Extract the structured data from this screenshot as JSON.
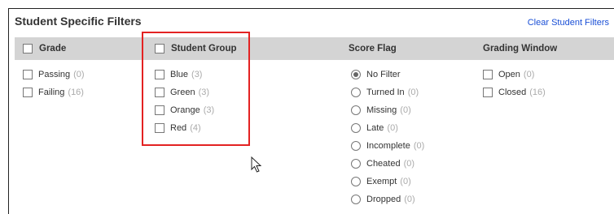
{
  "title": "Student Specific Filters",
  "clear_link": "Clear Student Filters",
  "columns": {
    "grade": {
      "header": "Grade",
      "items": [
        {
          "label": "Passing",
          "count": "(0)"
        },
        {
          "label": "Failing",
          "count": "(16)"
        }
      ]
    },
    "student_group": {
      "header": "Student Group",
      "items": [
        {
          "label": "Blue",
          "count": "(3)"
        },
        {
          "label": "Green",
          "count": "(3)"
        },
        {
          "label": "Orange",
          "count": "(3)"
        },
        {
          "label": "Red",
          "count": "(4)"
        }
      ]
    },
    "score_flag": {
      "header": "Score Flag",
      "selected": "No Filter",
      "items": [
        {
          "label": "No Filter",
          "count": ""
        },
        {
          "label": "Turned In",
          "count": "(0)"
        },
        {
          "label": "Missing",
          "count": "(0)"
        },
        {
          "label": "Late",
          "count": "(0)"
        },
        {
          "label": "Incomplete",
          "count": "(0)"
        },
        {
          "label": "Cheated",
          "count": "(0)"
        },
        {
          "label": "Exempt",
          "count": "(0)"
        },
        {
          "label": "Dropped",
          "count": "(0)"
        }
      ]
    },
    "grading_window": {
      "header": "Grading Window",
      "items": [
        {
          "label": "Open",
          "count": "(0)"
        },
        {
          "label": "Closed",
          "count": "(16)"
        }
      ]
    }
  },
  "icons": {
    "cursor": "mouse-pointer-icon",
    "checkbox": "checkbox-icon",
    "radio": "radio-icon"
  },
  "colors": {
    "highlight": "#e32222",
    "link": "#1a4fd6",
    "header_bar": "#d4d4d4",
    "count_text": "#aaaaaa"
  }
}
